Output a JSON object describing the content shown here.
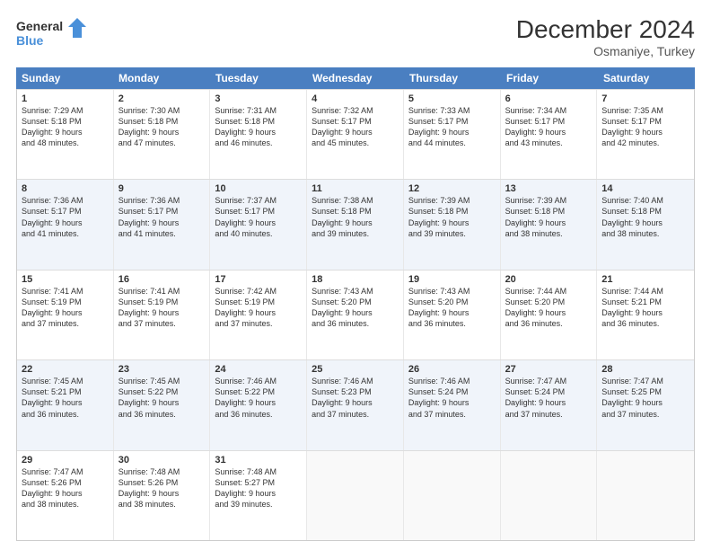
{
  "header": {
    "logo_line1": "General",
    "logo_line2": "Blue",
    "title": "December 2024",
    "subtitle": "Osmaniye, Turkey"
  },
  "weekdays": [
    "Sunday",
    "Monday",
    "Tuesday",
    "Wednesday",
    "Thursday",
    "Friday",
    "Saturday"
  ],
  "rows": [
    [
      {
        "day": "1",
        "lines": [
          "Sunrise: 7:29 AM",
          "Sunset: 5:18 PM",
          "Daylight: 9 hours",
          "and 48 minutes."
        ]
      },
      {
        "day": "2",
        "lines": [
          "Sunrise: 7:30 AM",
          "Sunset: 5:18 PM",
          "Daylight: 9 hours",
          "and 47 minutes."
        ]
      },
      {
        "day": "3",
        "lines": [
          "Sunrise: 7:31 AM",
          "Sunset: 5:18 PM",
          "Daylight: 9 hours",
          "and 46 minutes."
        ]
      },
      {
        "day": "4",
        "lines": [
          "Sunrise: 7:32 AM",
          "Sunset: 5:17 PM",
          "Daylight: 9 hours",
          "and 45 minutes."
        ]
      },
      {
        "day": "5",
        "lines": [
          "Sunrise: 7:33 AM",
          "Sunset: 5:17 PM",
          "Daylight: 9 hours",
          "and 44 minutes."
        ]
      },
      {
        "day": "6",
        "lines": [
          "Sunrise: 7:34 AM",
          "Sunset: 5:17 PM",
          "Daylight: 9 hours",
          "and 43 minutes."
        ]
      },
      {
        "day": "7",
        "lines": [
          "Sunrise: 7:35 AM",
          "Sunset: 5:17 PM",
          "Daylight: 9 hours",
          "and 42 minutes."
        ]
      }
    ],
    [
      {
        "day": "8",
        "lines": [
          "Sunrise: 7:36 AM",
          "Sunset: 5:17 PM",
          "Daylight: 9 hours",
          "and 41 minutes."
        ]
      },
      {
        "day": "9",
        "lines": [
          "Sunrise: 7:36 AM",
          "Sunset: 5:17 PM",
          "Daylight: 9 hours",
          "and 41 minutes."
        ]
      },
      {
        "day": "10",
        "lines": [
          "Sunrise: 7:37 AM",
          "Sunset: 5:17 PM",
          "Daylight: 9 hours",
          "and 40 minutes."
        ]
      },
      {
        "day": "11",
        "lines": [
          "Sunrise: 7:38 AM",
          "Sunset: 5:18 PM",
          "Daylight: 9 hours",
          "and 39 minutes."
        ]
      },
      {
        "day": "12",
        "lines": [
          "Sunrise: 7:39 AM",
          "Sunset: 5:18 PM",
          "Daylight: 9 hours",
          "and 39 minutes."
        ]
      },
      {
        "day": "13",
        "lines": [
          "Sunrise: 7:39 AM",
          "Sunset: 5:18 PM",
          "Daylight: 9 hours",
          "and 38 minutes."
        ]
      },
      {
        "day": "14",
        "lines": [
          "Sunrise: 7:40 AM",
          "Sunset: 5:18 PM",
          "Daylight: 9 hours",
          "and 38 minutes."
        ]
      }
    ],
    [
      {
        "day": "15",
        "lines": [
          "Sunrise: 7:41 AM",
          "Sunset: 5:19 PM",
          "Daylight: 9 hours",
          "and 37 minutes."
        ]
      },
      {
        "day": "16",
        "lines": [
          "Sunrise: 7:41 AM",
          "Sunset: 5:19 PM",
          "Daylight: 9 hours",
          "and 37 minutes."
        ]
      },
      {
        "day": "17",
        "lines": [
          "Sunrise: 7:42 AM",
          "Sunset: 5:19 PM",
          "Daylight: 9 hours",
          "and 37 minutes."
        ]
      },
      {
        "day": "18",
        "lines": [
          "Sunrise: 7:43 AM",
          "Sunset: 5:20 PM",
          "Daylight: 9 hours",
          "and 36 minutes."
        ]
      },
      {
        "day": "19",
        "lines": [
          "Sunrise: 7:43 AM",
          "Sunset: 5:20 PM",
          "Daylight: 9 hours",
          "and 36 minutes."
        ]
      },
      {
        "day": "20",
        "lines": [
          "Sunrise: 7:44 AM",
          "Sunset: 5:20 PM",
          "Daylight: 9 hours",
          "and 36 minutes."
        ]
      },
      {
        "day": "21",
        "lines": [
          "Sunrise: 7:44 AM",
          "Sunset: 5:21 PM",
          "Daylight: 9 hours",
          "and 36 minutes."
        ]
      }
    ],
    [
      {
        "day": "22",
        "lines": [
          "Sunrise: 7:45 AM",
          "Sunset: 5:21 PM",
          "Daylight: 9 hours",
          "and 36 minutes."
        ]
      },
      {
        "day": "23",
        "lines": [
          "Sunrise: 7:45 AM",
          "Sunset: 5:22 PM",
          "Daylight: 9 hours",
          "and 36 minutes."
        ]
      },
      {
        "day": "24",
        "lines": [
          "Sunrise: 7:46 AM",
          "Sunset: 5:22 PM",
          "Daylight: 9 hours",
          "and 36 minutes."
        ]
      },
      {
        "day": "25",
        "lines": [
          "Sunrise: 7:46 AM",
          "Sunset: 5:23 PM",
          "Daylight: 9 hours",
          "and 37 minutes."
        ]
      },
      {
        "day": "26",
        "lines": [
          "Sunrise: 7:46 AM",
          "Sunset: 5:24 PM",
          "Daylight: 9 hours",
          "and 37 minutes."
        ]
      },
      {
        "day": "27",
        "lines": [
          "Sunrise: 7:47 AM",
          "Sunset: 5:24 PM",
          "Daylight: 9 hours",
          "and 37 minutes."
        ]
      },
      {
        "day": "28",
        "lines": [
          "Sunrise: 7:47 AM",
          "Sunset: 5:25 PM",
          "Daylight: 9 hours",
          "and 37 minutes."
        ]
      }
    ],
    [
      {
        "day": "29",
        "lines": [
          "Sunrise: 7:47 AM",
          "Sunset: 5:26 PM",
          "Daylight: 9 hours",
          "and 38 minutes."
        ]
      },
      {
        "day": "30",
        "lines": [
          "Sunrise: 7:48 AM",
          "Sunset: 5:26 PM",
          "Daylight: 9 hours",
          "and 38 minutes."
        ]
      },
      {
        "day": "31",
        "lines": [
          "Sunrise: 7:48 AM",
          "Sunset: 5:27 PM",
          "Daylight: 9 hours",
          "and 39 minutes."
        ]
      },
      null,
      null,
      null,
      null
    ]
  ]
}
